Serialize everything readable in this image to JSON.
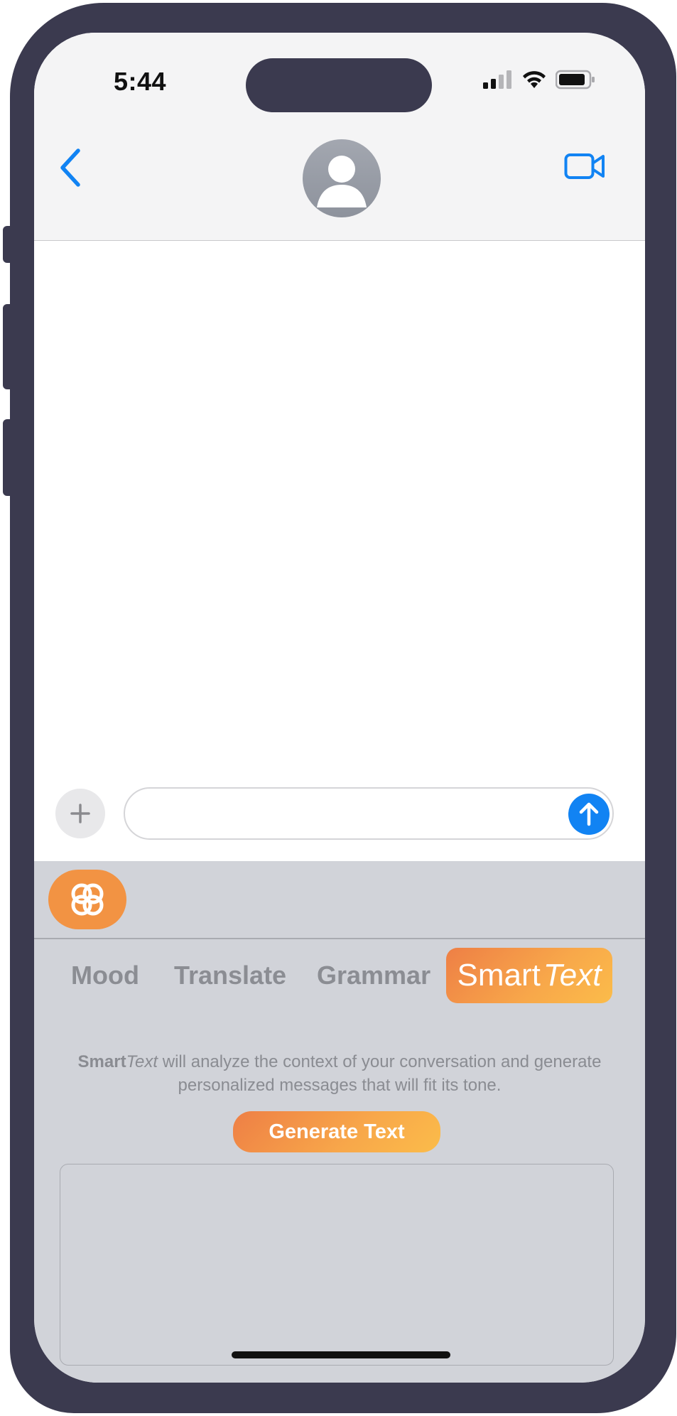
{
  "status_bar": {
    "time": "5:44",
    "icons": [
      "cellular-signal-icon",
      "wifi-icon",
      "battery-icon"
    ]
  },
  "nav": {
    "back_icon": "chevron-left-icon",
    "contact_icon": "person-avatar-icon",
    "video_call_icon": "facetime-video-icon"
  },
  "input_bar": {
    "add_icon": "plus-icon",
    "message_value": "",
    "message_placeholder": "",
    "send_icon": "arrow-up-icon"
  },
  "panel": {
    "app_icon": "linked-rings-icon",
    "tabs": [
      {
        "label": "Mood"
      },
      {
        "label": "Translate"
      },
      {
        "label": "Grammar"
      }
    ],
    "active_tab": {
      "label_bold": "Smart",
      "label_italic": "Text"
    },
    "description": {
      "bold": "Smart",
      "italic": "Text",
      "rest": " will analyze the context of your conversation and generate personalized messages that will fit its tone."
    },
    "generate_button": "Generate Text",
    "output_text": ""
  },
  "colors": {
    "accent_orange": "#f29343",
    "gradient_start": "#ee7f45",
    "gradient_end": "#fbbc4a",
    "ios_blue": "#1183f3",
    "frame": "#3b3a4f",
    "panel_bg": "#d1d3d9"
  }
}
